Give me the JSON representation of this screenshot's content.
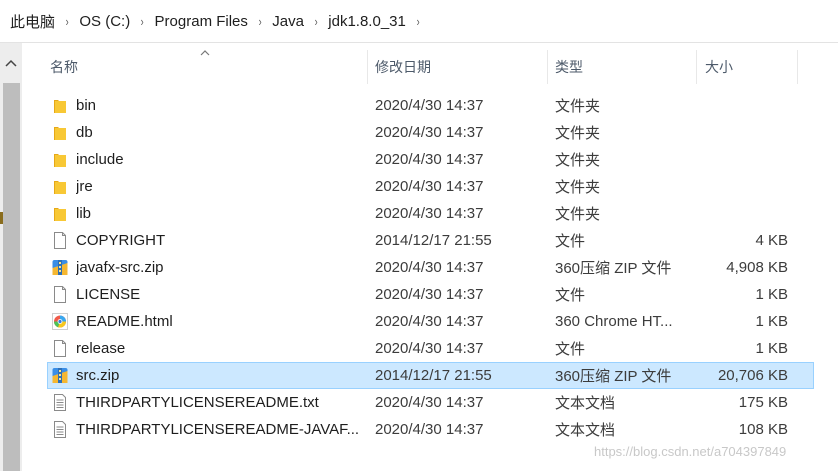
{
  "breadcrumb": {
    "segments": [
      "此电脑",
      "OS (C:)",
      "Program Files",
      "Java",
      "jdk1.8.0_31"
    ],
    "separator": "›"
  },
  "columns": {
    "name": "名称",
    "date": "修改日期",
    "type": "类型",
    "size": "大小"
  },
  "files": [
    {
      "name": "bin",
      "date": "2020/4/30 14:37",
      "type": "文件夹",
      "size": "",
      "icon": "folder-icon"
    },
    {
      "name": "db",
      "date": "2020/4/30 14:37",
      "type": "文件夹",
      "size": "",
      "icon": "folder-icon"
    },
    {
      "name": "include",
      "date": "2020/4/30 14:37",
      "type": "文件夹",
      "size": "",
      "icon": "folder-icon"
    },
    {
      "name": "jre",
      "date": "2020/4/30 14:37",
      "type": "文件夹",
      "size": "",
      "icon": "folder-icon"
    },
    {
      "name": "lib",
      "date": "2020/4/30 14:37",
      "type": "文件夹",
      "size": "",
      "icon": "folder-icon"
    },
    {
      "name": "COPYRIGHT",
      "date": "2014/12/17 21:55",
      "type": "文件",
      "size": "4 KB",
      "icon": "file-icon"
    },
    {
      "name": "javafx-src.zip",
      "date": "2020/4/30 14:37",
      "type": "360压缩 ZIP 文件",
      "size": "4,908 KB",
      "icon": "zip-archive-icon"
    },
    {
      "name": "LICENSE",
      "date": "2020/4/30 14:37",
      "type": "文件",
      "size": "1 KB",
      "icon": "file-icon"
    },
    {
      "name": "README.html",
      "date": "2020/4/30 14:37",
      "type": "360 Chrome HT...",
      "size": "1 KB",
      "icon": "browser-html-icon"
    },
    {
      "name": "release",
      "date": "2020/4/30 14:37",
      "type": "文件",
      "size": "1 KB",
      "icon": "file-icon"
    },
    {
      "name": "src.zip",
      "date": "2014/12/17 21:55",
      "type": "360压缩 ZIP 文件",
      "size": "20,706 KB",
      "icon": "zip-archive-icon",
      "selected": true
    },
    {
      "name": "THIRDPARTYLICENSEREADME.txt",
      "date": "2020/4/30 14:37",
      "type": "文本文档",
      "size": "175 KB",
      "icon": "text-document-icon"
    },
    {
      "name": "THIRDPARTYLICENSEREADME-JAVAF...",
      "date": "2020/4/30 14:37",
      "type": "文本文档",
      "size": "108 KB",
      "icon": "text-document-icon"
    }
  ],
  "watermark": "https://blog.csdn.net/a704397849",
  "colors": {
    "selection": "#cce8ff",
    "selection_border": "#99d1ff",
    "folder": "#f8c835",
    "header_text": "#4d5a6a"
  }
}
